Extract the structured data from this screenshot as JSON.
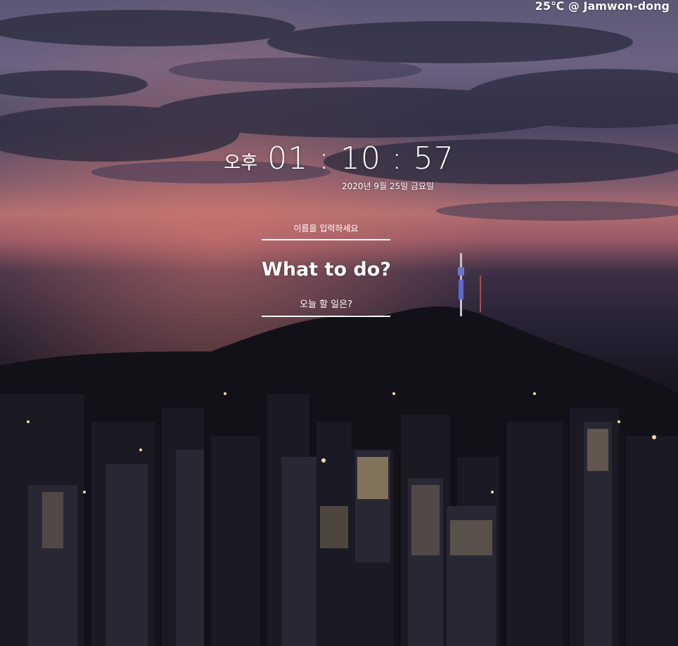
{
  "weather": {
    "text": "25℃ @ Jamwon-dong"
  },
  "clock": {
    "ampm": "오후",
    "time": "01 : 10 : 57",
    "date": "2020년 9월 25일 금요일"
  },
  "name_input": {
    "placeholder": "이름을 입력하세요"
  },
  "todo": {
    "title": "What to do?",
    "placeholder": "오늘 할 일은?"
  }
}
